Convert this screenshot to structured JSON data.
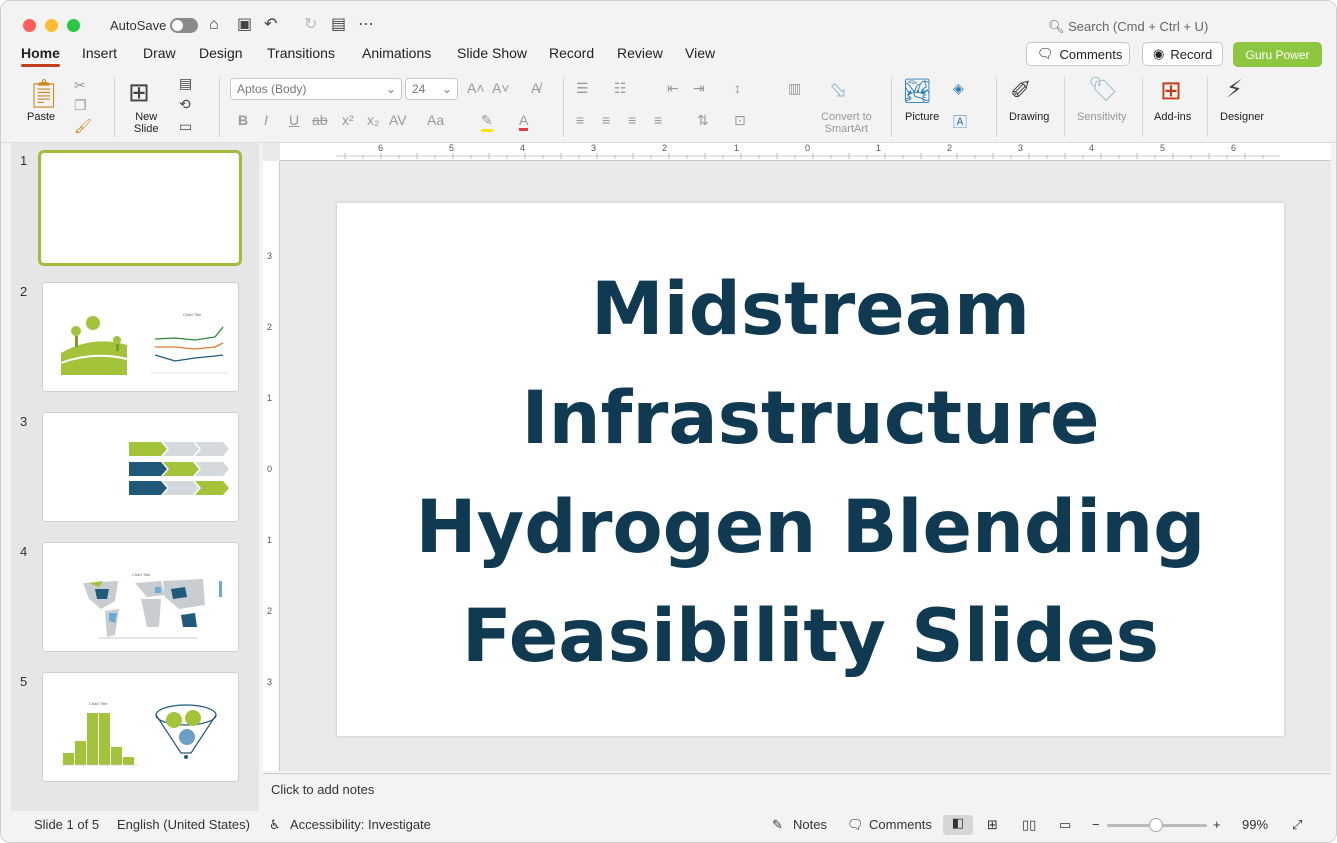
{
  "titlebar": {
    "autosave_label": "AutoSave",
    "search_placeholder": "Search (Cmd + Ctrl + U)"
  },
  "tabs": [
    {
      "label": "Home"
    },
    {
      "label": "Insert"
    },
    {
      "label": "Draw"
    },
    {
      "label": "Design"
    },
    {
      "label": "Transitions"
    },
    {
      "label": "Animations"
    },
    {
      "label": "Slide Show"
    },
    {
      "label": "Record"
    },
    {
      "label": "Review"
    },
    {
      "label": "View"
    }
  ],
  "right_buttons": {
    "comments": "Comments",
    "record": "Record",
    "guru": "Guru Power"
  },
  "ribbon": {
    "paste": "Paste",
    "new_slide": "New\nSlide",
    "font_name": "Aptos (Body)",
    "font_size": "24",
    "smartart": "Convert to\nSmartArt",
    "picture": "Picture",
    "drawing": "Drawing",
    "sensitivity": "Sensitivity",
    "addins": "Add-ins",
    "designer": "Designer"
  },
  "slides": [
    {
      "number": "1"
    },
    {
      "number": "2"
    },
    {
      "number": "3"
    },
    {
      "number": "4"
    },
    {
      "number": "5"
    }
  ],
  "thumb_labels": {
    "chart_title": "Chart Title"
  },
  "slide_title": "Midstream Infrastructure Hydrogen Blending Feasibility Slides",
  "notes_placeholder": "Click to add notes",
  "status": {
    "slide_count": "Slide 1 of 5",
    "language": "English (United States)",
    "accessibility": "Accessibility: Investigate",
    "notes": "Notes",
    "comments": "Comments",
    "zoom": "99%"
  },
  "ruler": {
    "h": [
      "6",
      "5",
      "4",
      "3",
      "2",
      "1",
      "0",
      "1",
      "2",
      "3",
      "4",
      "5",
      "6"
    ],
    "v": [
      "3",
      "2",
      "1",
      "0",
      "1",
      "2",
      "3"
    ]
  },
  "colors": {
    "accent": "#c43e1c",
    "title": "#0f3a52",
    "green": "#a3c43a",
    "navy": "#1f5a7a"
  }
}
